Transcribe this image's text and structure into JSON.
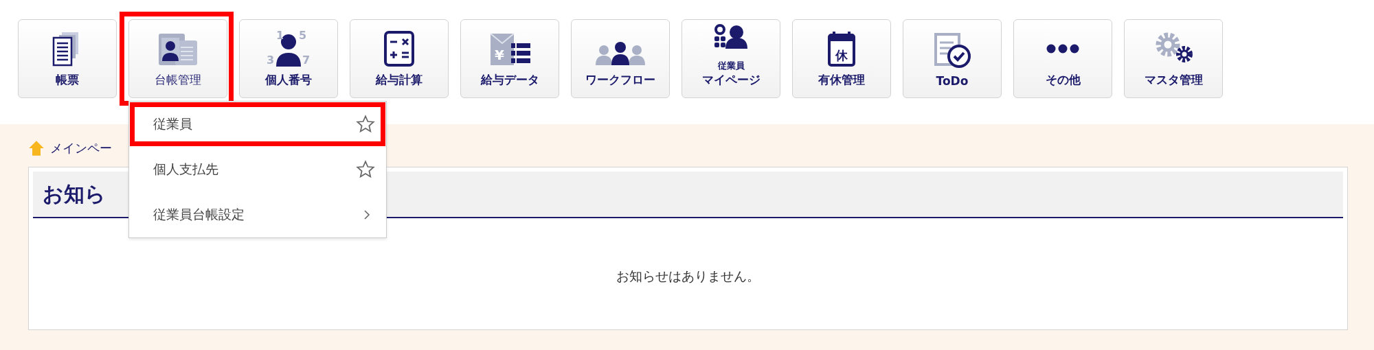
{
  "toolbar": [
    {
      "label": "帳票",
      "selected": false
    },
    {
      "label": "台帳管理",
      "selected": true
    },
    {
      "label": "個人番号",
      "selected": false,
      "icon_text": [
        "1",
        "5",
        "3",
        "7"
      ]
    },
    {
      "label": "給与計算",
      "selected": false
    },
    {
      "label": "給与データ",
      "selected": false,
      "icon_text": [
        "¥"
      ]
    },
    {
      "label": "ワークフロー",
      "selected": false
    },
    {
      "label": "マイページ",
      "caption": "従業員",
      "selected": false
    },
    {
      "label": "有休管理",
      "selected": false,
      "icon_text": [
        "休"
      ]
    },
    {
      "label": "ToDo",
      "selected": false
    },
    {
      "label": "その他",
      "selected": false
    },
    {
      "label": "マスタ管理",
      "selected": false
    }
  ],
  "dropdown": {
    "items": [
      {
        "label": "従業員",
        "kind": "favorite",
        "selected": true
      },
      {
        "label": "個人支払先",
        "kind": "favorite",
        "selected": false
      },
      {
        "label": "従業員台帳設定",
        "kind": "submenu",
        "selected": false
      }
    ]
  },
  "breadcrumb": {
    "label": "メインペー"
  },
  "notice_panel": {
    "title": "お知ら",
    "message": "お知らせはありません。"
  }
}
